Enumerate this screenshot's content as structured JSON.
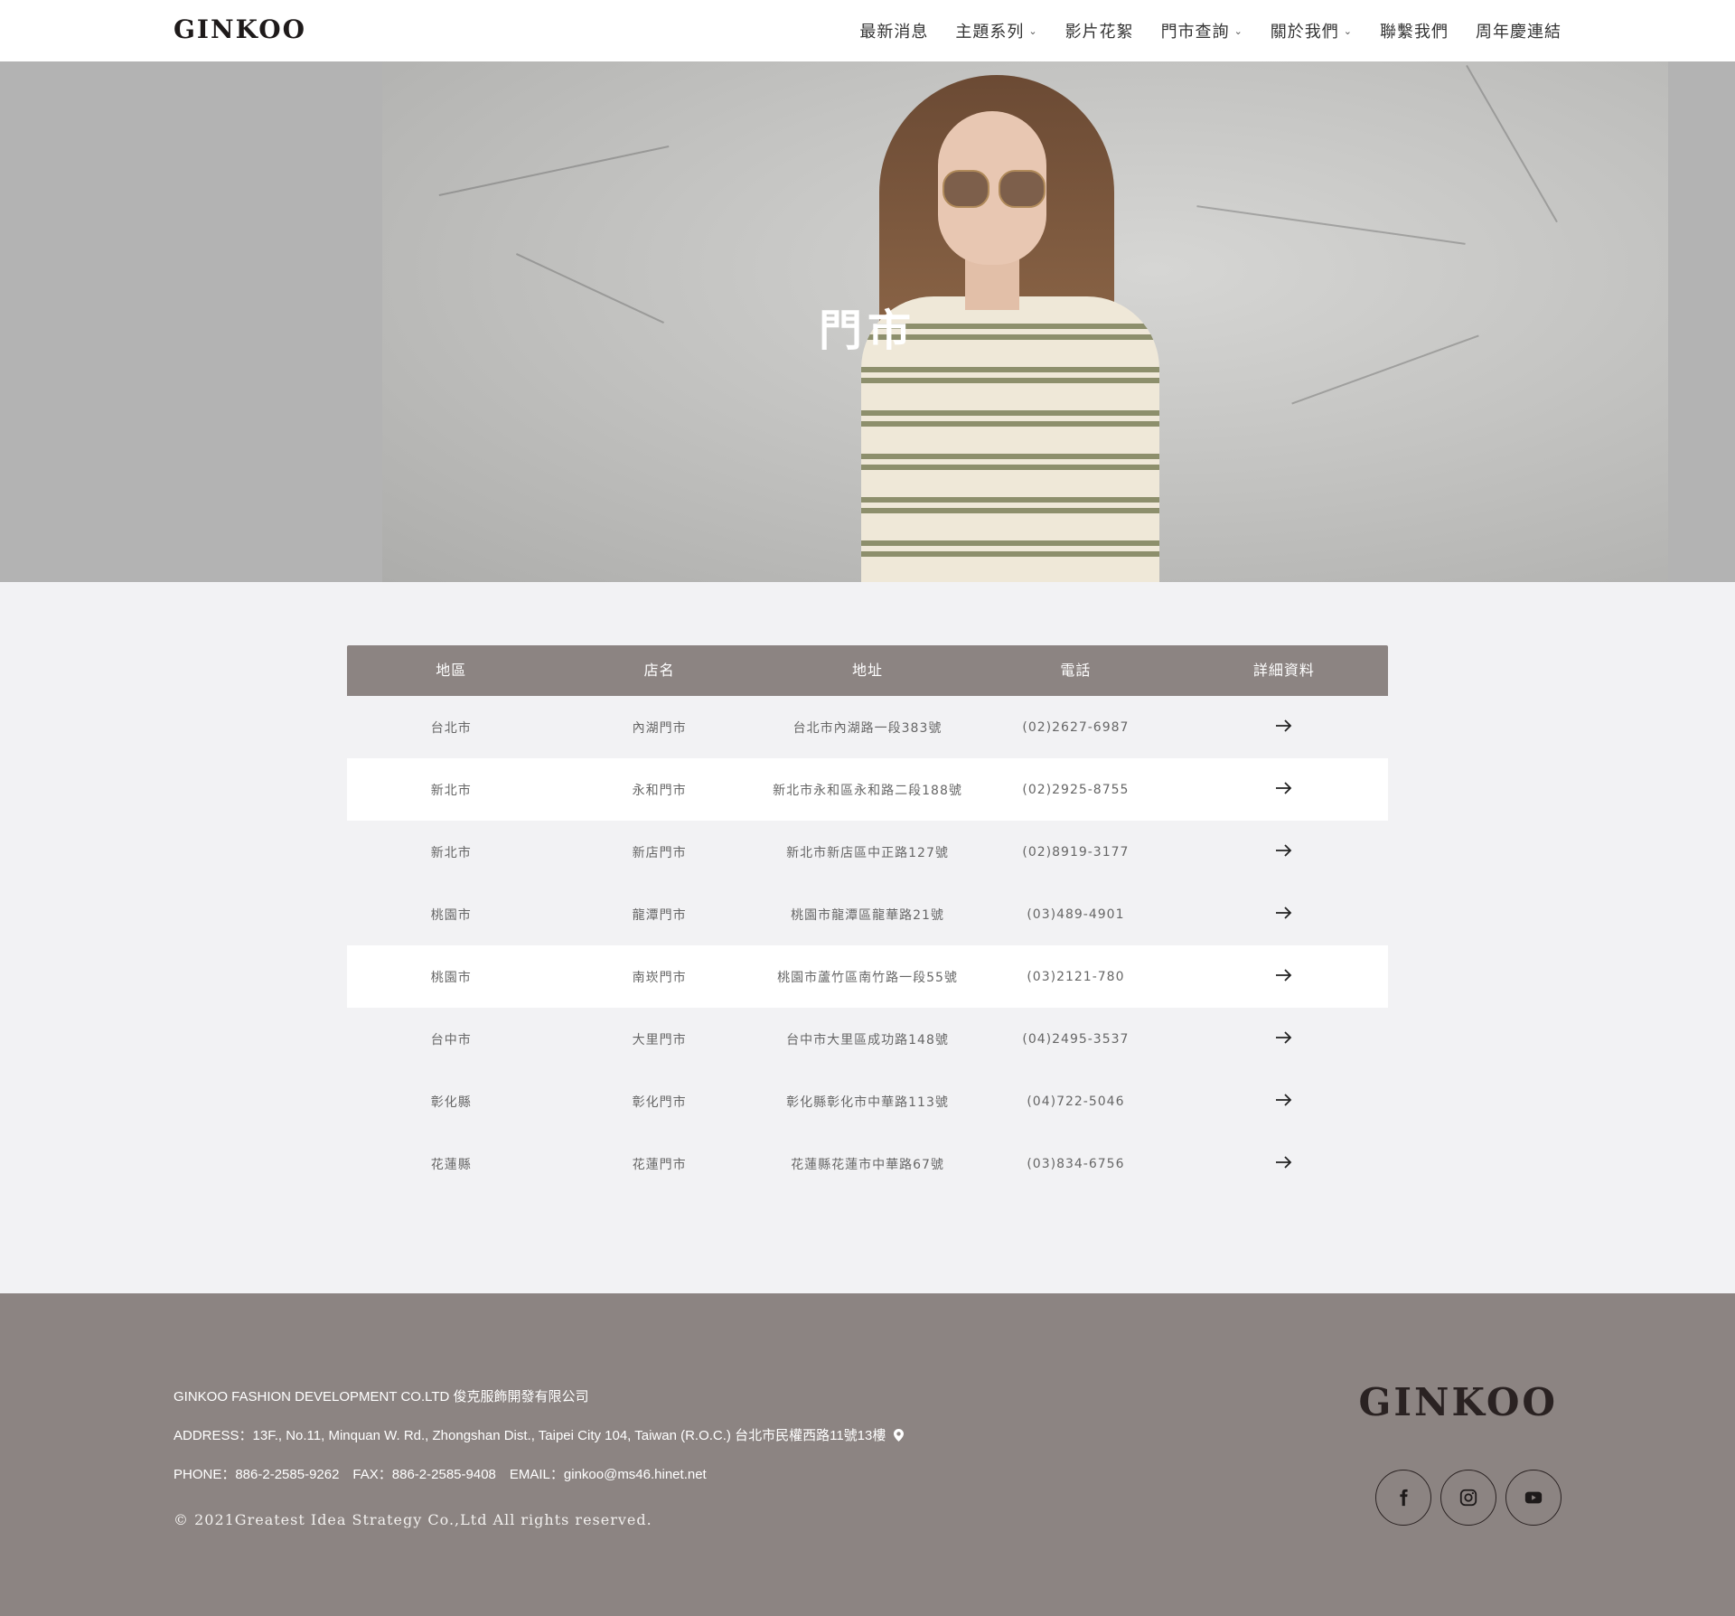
{
  "header": {
    "logo": "GINKOO",
    "nav": [
      {
        "label": "最新消息",
        "has_dropdown": false
      },
      {
        "label": "主題系列",
        "has_dropdown": true
      },
      {
        "label": "影片花絮",
        "has_dropdown": false
      },
      {
        "label": "門市查詢",
        "has_dropdown": true
      },
      {
        "label": "關於我們",
        "has_dropdown": true
      },
      {
        "label": "聯繫我們",
        "has_dropdown": false
      },
      {
        "label": "周年慶連結",
        "has_dropdown": false
      }
    ],
    "dropdown_icon": "chevron-down-icon"
  },
  "hero": {
    "title": "門市"
  },
  "table": {
    "headers": [
      "地區",
      "店名",
      "地址",
      "電話",
      "詳細資料"
    ],
    "rows": [
      {
        "region": "台北市",
        "name": "內湖門市",
        "address": "台北市內湖路一段383號",
        "phone": "(02)2627-6987"
      },
      {
        "region": "新北市",
        "name": "永和門市",
        "address": "新北市永和區永和路二段188號",
        "phone": "(02)2925-8755"
      },
      {
        "region": "新北市",
        "name": "新店門市",
        "address": "新北市新店區中正路127號",
        "phone": "(02)8919-3177"
      },
      {
        "region": "桃園市",
        "name": "龍潭門市",
        "address": "桃園市龍潭區龍華路21號",
        "phone": "(03)489-4901"
      },
      {
        "region": "桃園市",
        "name": "南崁門市",
        "address": "桃園市蘆竹區南竹路一段55號",
        "phone": "(03)2121-780"
      },
      {
        "region": "台中市",
        "name": "大里門市",
        "address": "台中市大里區成功路148號",
        "phone": "(04)2495-3537"
      },
      {
        "region": "彰化縣",
        "name": "彰化門市",
        "address": "彰化縣彰化市中華路113號",
        "phone": "(04)722-5046"
      },
      {
        "region": "花蓮縣",
        "name": "花蓮門市",
        "address": "花蓮縣花蓮市中華路67號",
        "phone": "(03)834-6756"
      }
    ],
    "detail_icon": "arrow-right-icon"
  },
  "footer": {
    "company": "GINKOO FASHION DEVELOPMENT CO.LTD 俊克服飾開發有限公司",
    "address": "ADDRESS：13F., No.11, Minquan W. Rd., Zhongshan Dist., Taipei City 104, Taiwan (R.O.C.) 台北市民權西路11號13樓",
    "address_icon": "map-pin-icon",
    "contact": "PHONE：886-2-2585-9262　FAX：886-2-2585-9408　EMAIL：ginkoo@ms46.hinet.net",
    "copyright": "© 2021Greatest Idea Strategy Co.,Ltd All rights reserved.",
    "logo": "GINKOO",
    "socials": [
      "facebook-icon",
      "instagram-icon",
      "youtube-icon"
    ]
  },
  "colors": {
    "table_header": "#8c8482",
    "footer_bg": "#8c8482",
    "page_bg": "#f2f2f4",
    "hero_side": "#b3b3b3"
  }
}
